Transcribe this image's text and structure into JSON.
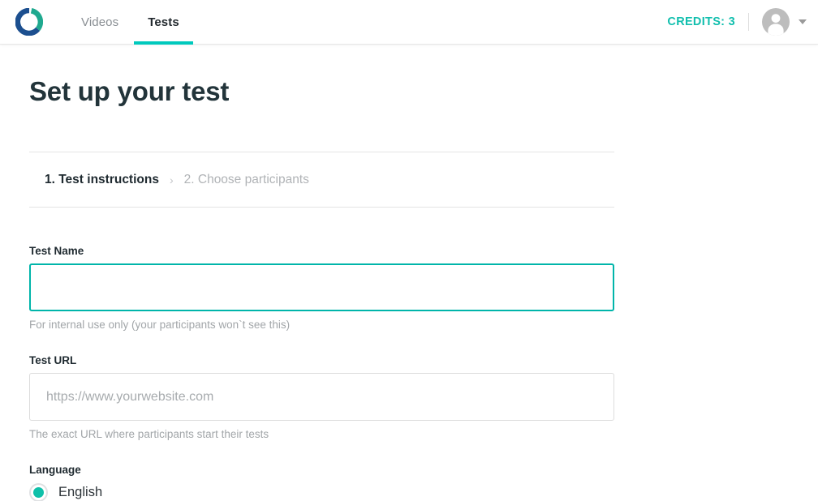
{
  "header": {
    "logo_name": "logo-ring-icon",
    "nav": [
      {
        "label": "Videos",
        "active": false
      },
      {
        "label": "Tests",
        "active": true
      }
    ],
    "credits_label": "CREDITS: 3",
    "avatar_name": "user-avatar",
    "caret_name": "chevron-down-icon",
    "accent_color": "#00c9bd",
    "credits_color": "#12bfae"
  },
  "main": {
    "page_title": "Set up your test",
    "steps": [
      {
        "label": "1. Test instructions",
        "current": true
      },
      {
        "label": "2. Choose participants",
        "current": false
      }
    ],
    "step_separator": "›",
    "fields": {
      "test_name": {
        "label": "Test Name",
        "value": "",
        "placeholder": "",
        "help": "For internal use only (your participants won`t see this)",
        "focused": true
      },
      "test_url": {
        "label": "Test URL",
        "value": "",
        "placeholder": "https://www.yourwebsite.com",
        "help": "The exact URL where participants start their tests",
        "focused": false
      },
      "language": {
        "label": "Language",
        "options": [
          {
            "label": "English",
            "selected": true
          }
        ]
      }
    }
  }
}
